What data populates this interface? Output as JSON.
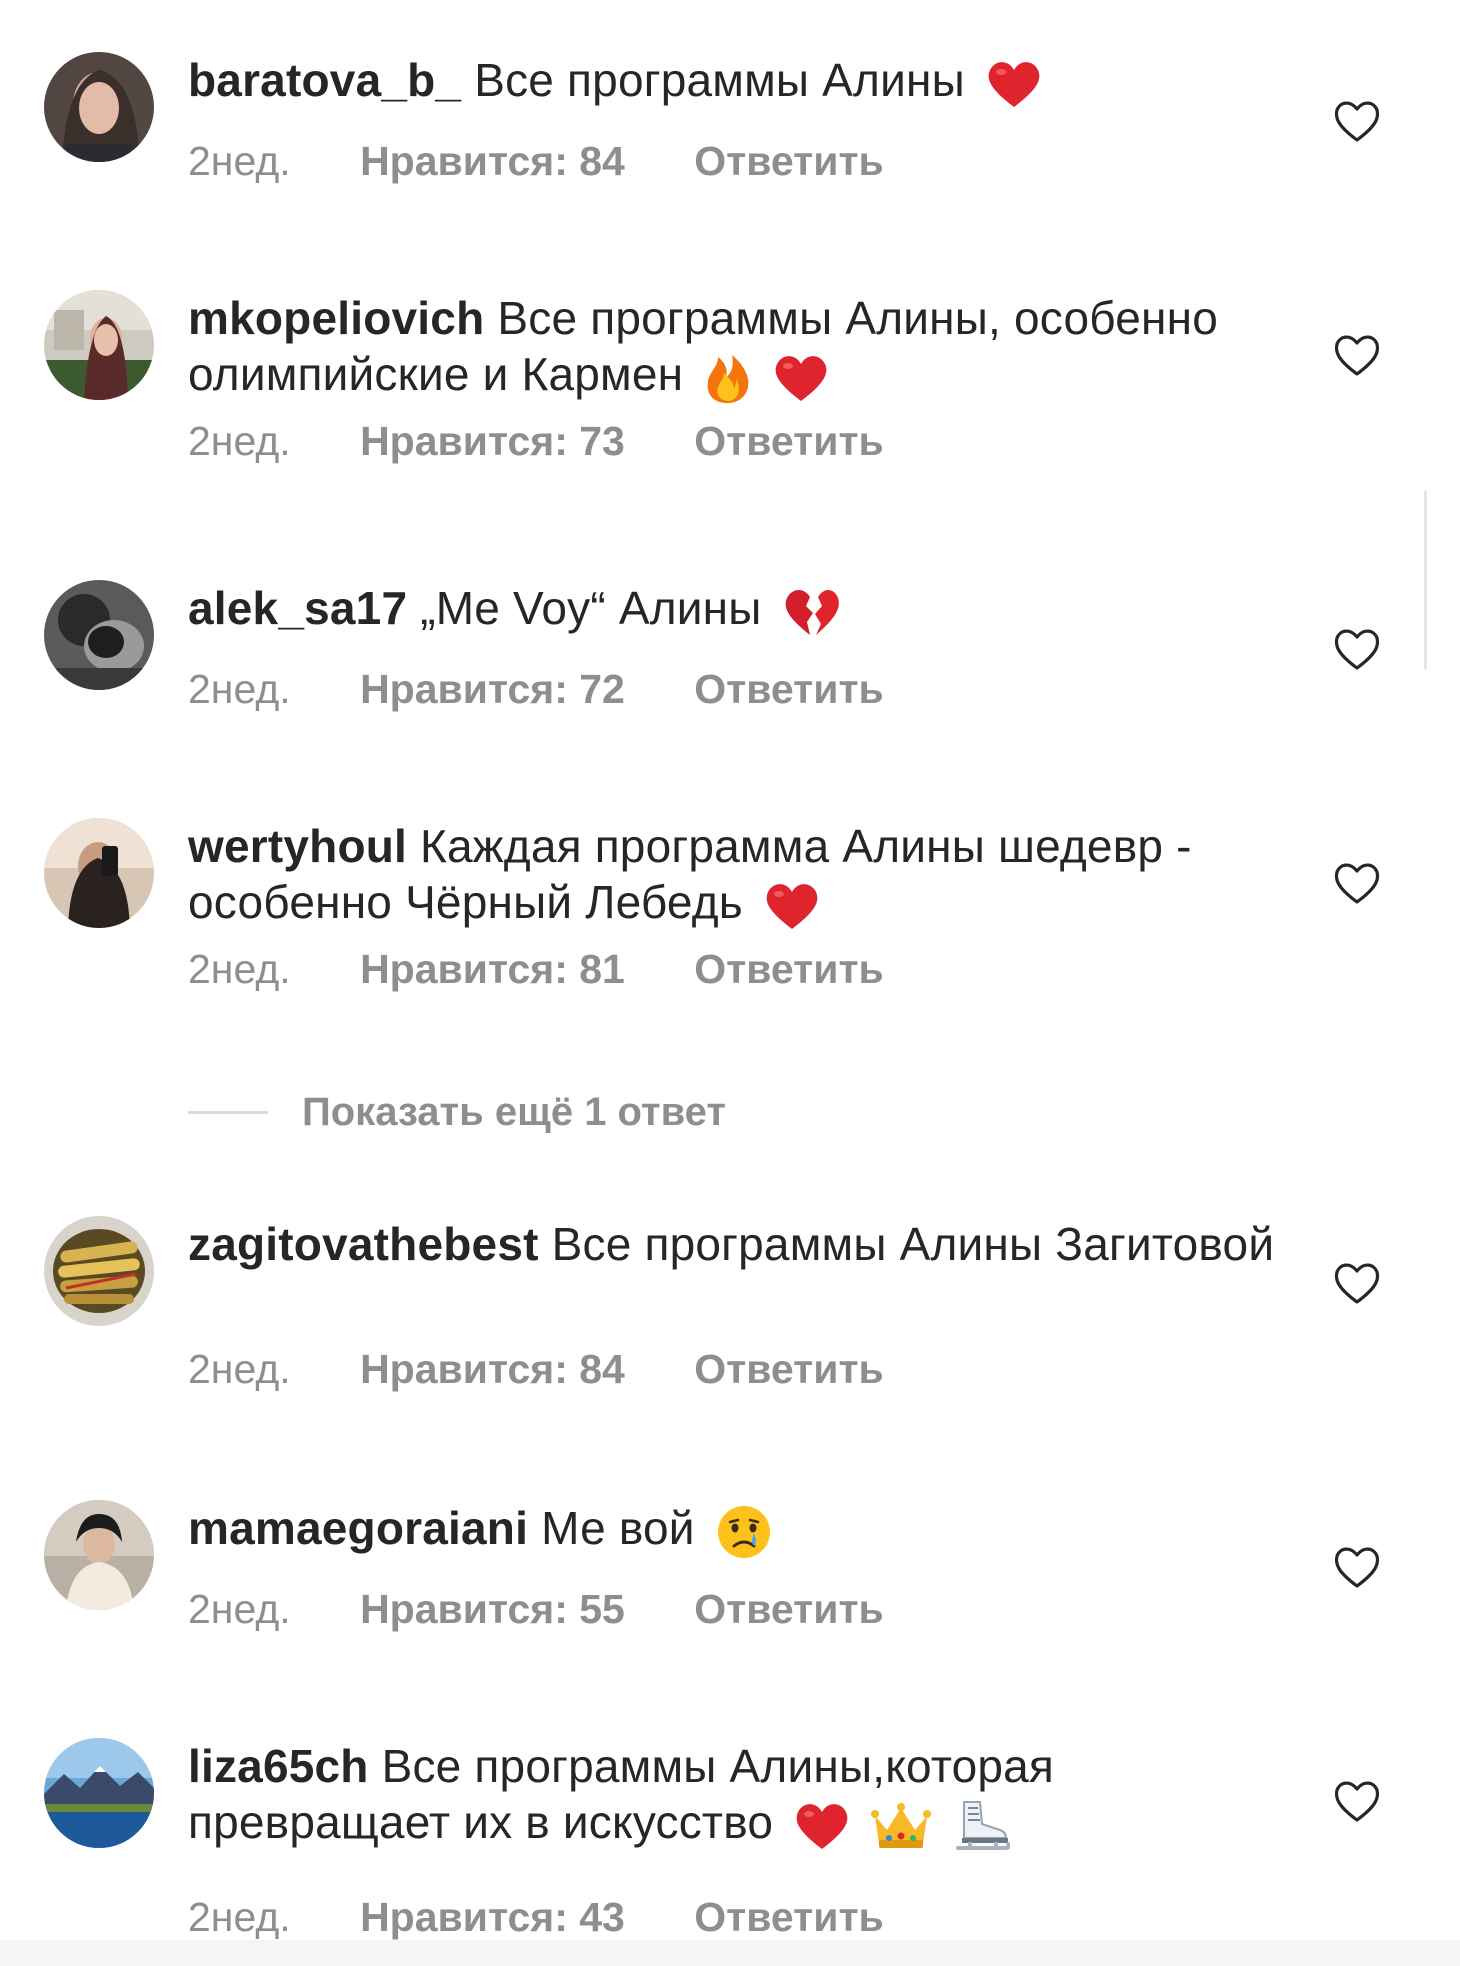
{
  "comments": [
    {
      "username": "baratova_b_",
      "text": "Все программы Алины",
      "emoji": [
        "red-heart"
      ],
      "time": "2нед.",
      "likes": "Нравится: 84",
      "reply": "Ответить",
      "avatar_colors": [
        "#3a3433",
        "#c9a697"
      ]
    },
    {
      "username": "mkopeliovich",
      "text": "Все программы Алины, особенно олимпийские и Кармен",
      "emoji": [
        "fire",
        "red-heart"
      ],
      "time": "2нед.",
      "likes": "Нравится: 73",
      "reply": "Ответить",
      "avatar_colors": [
        "#4a5a3a",
        "#d8d2c6"
      ]
    },
    {
      "username": "alek_sa17",
      "text": "„Me Voy“ Алины",
      "emoji": [
        "broken-heart"
      ],
      "time": "2нед.",
      "likes": "Нравится: 72",
      "reply": "Ответить",
      "avatar_colors": [
        "#2c2c2c",
        "#8c8c8c"
      ]
    },
    {
      "username": "wertyhoul",
      "text": "Каждая программа Алины шедевр - особенно Чёрный Лебедь",
      "emoji": [
        "red-heart"
      ],
      "time": "2нед.",
      "likes": "Нравится: 81",
      "reply": "Ответить",
      "avatar_colors": [
        "#6b5a4c",
        "#e8d8c8"
      ]
    },
    {
      "username": "zagitovathebest",
      "text": "Все программы Алины Загитовой",
      "emoji": [],
      "time": "2нед.",
      "likes": "Нравится: 84",
      "reply": "Ответить",
      "avatar_colors": [
        "#9a7a2a",
        "#e0c070"
      ]
    },
    {
      "username": "mamaegoraiani",
      "text": "Ме вой",
      "emoji": [
        "crying-face"
      ],
      "time": "2нед.",
      "likes": "Нравится: 55",
      "reply": "Ответить",
      "avatar_colors": [
        "#2a2a2a",
        "#efe6da"
      ]
    },
    {
      "username": "liza65ch",
      "text": "Все программы Алины,которая превращает их в искусство",
      "emoji": [
        "red-heart",
        "crown",
        "ice-skate"
      ],
      "time": "2нед.",
      "likes": "Нравится: 43",
      "reply": "Ответить",
      "avatar_colors": [
        "#2a4a8a",
        "#9cc8e8"
      ]
    }
  ],
  "show_replies": "Показать ещё 1 ответ",
  "colors": {
    "text": "#262626",
    "meta": "#8e8e8e",
    "divider": "#dbdbdb",
    "heart_red": "#e0242e"
  }
}
